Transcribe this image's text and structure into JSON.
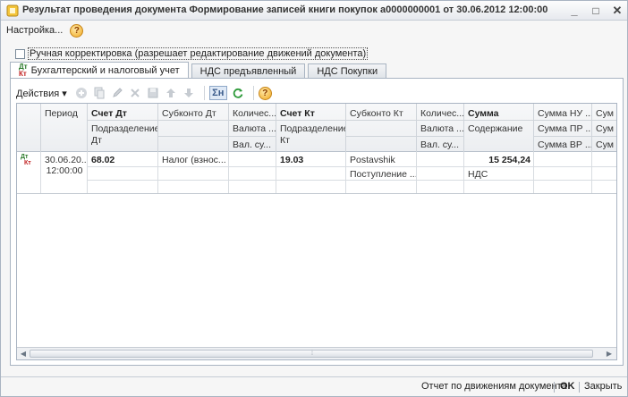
{
  "window": {
    "title": "Результат проведения документа Формирование записей книги покупок а0000000001 от 30.06.2012 12:00:00",
    "controls": {
      "minimize": "_",
      "restore": "□",
      "close": "✕"
    }
  },
  "menu": {
    "settings": "Настройка...",
    "help": "?"
  },
  "manual_adjust": {
    "label": "Ручная корректировка (разрешает редактирование движений документа)",
    "checked": false
  },
  "tabs": [
    {
      "label": "Бухгалтерский и налоговый учет",
      "icon": "dt-kt-icon",
      "active": true
    },
    {
      "label": "НДС предъявленный",
      "active": false
    },
    {
      "label": "НДС Покупки",
      "active": false
    }
  ],
  "toolbar": {
    "actions_label": "Действия ▾",
    "sum_label": "Σн",
    "help": "?"
  },
  "table": {
    "headers": {
      "period": "Период",
      "account_dt": "Счет Дт",
      "subconto_dt": "Субконто Дт",
      "qty_dt": "Количес...",
      "currency_dt": "Валюта ...",
      "cur_sum_dt": "Вал. су...",
      "division_dt": "Подразделение Дт",
      "account_kt": "Счет Кт",
      "subconto_kt": "Субконто Кт",
      "qty_kt": "Количес...",
      "currency_kt": "Валюта ...",
      "cur_sum_kt": "Вал. су...",
      "division_kt": "Подразделение Кт",
      "sum": "Сумма",
      "content": "Содержание",
      "sum_nu": "Сумма НУ ...",
      "sum_pr": "Сумма ПР ...",
      "sum_vr": "Сумма ВР ...",
      "extra1": "Сум",
      "extra2": "Сум",
      "extra3": "Сум"
    },
    "rows": [
      {
        "period_date": "30.06.20...",
        "period_time": "12:00:00",
        "account_dt": "68.02",
        "subconto_dt": "Налог (взнос...",
        "account_kt": "19.03",
        "subconto_kt_1": "Postavshik",
        "subconto_kt_2": "Поступление ...",
        "sum": "15 254,24",
        "content": "НДС"
      }
    ]
  },
  "statusbar": {
    "report": "Отчет по движениям документа",
    "ok": "OK",
    "close": "Закрыть"
  }
}
